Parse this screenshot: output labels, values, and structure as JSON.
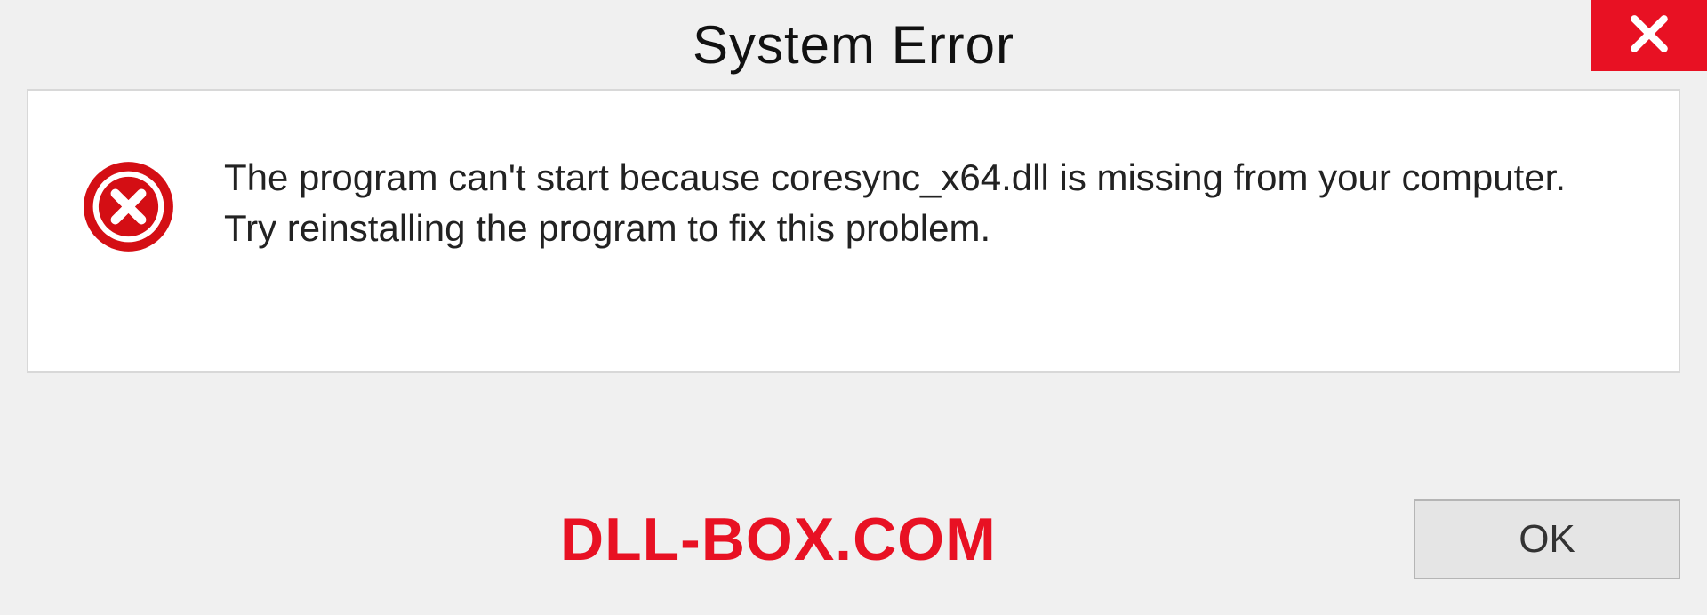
{
  "dialog": {
    "title": "System Error",
    "message": "The program can't start because coresync_x64.dll is missing from your computer. Try reinstalling the program to fix this problem.",
    "ok_label": "OK"
  },
  "watermark": "DLL-BOX.COM"
}
